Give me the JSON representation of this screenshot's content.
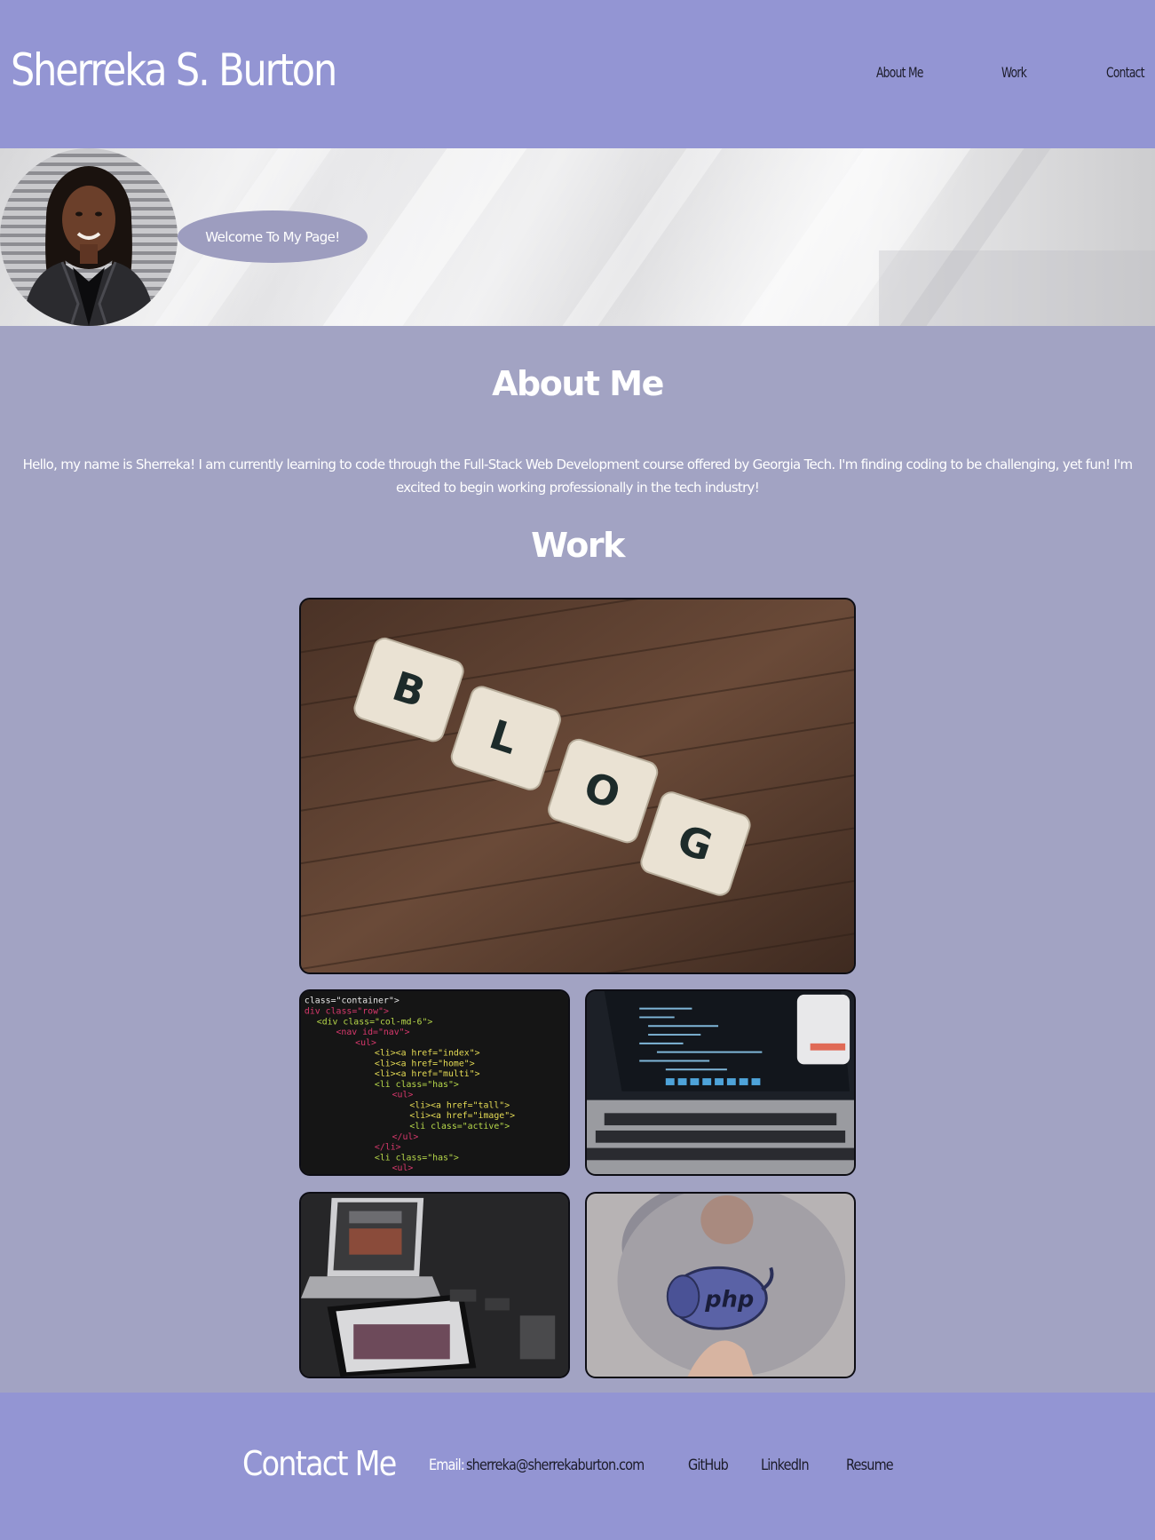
{
  "header": {
    "site_title": "Sherreka S. Burton",
    "nav": {
      "about": "About Me",
      "work": "Work",
      "contact": "Contact"
    },
    "background_color": "#9395d3"
  },
  "hero": {
    "welcome_text": "Welcome To My Page!",
    "avatar_alt": "profile-photo"
  },
  "about": {
    "title": "About Me",
    "text": "Hello, my name is Sherreka! I am currently learning to code through the Full-Stack Web Development course offered by Georgia Tech. I'm finding coding to be challenging, yet fun! I'm excited to begin working professionally in the tech industry!"
  },
  "work": {
    "title": "Work",
    "cards": [
      {
        "image": "blog-tiles-photo"
      },
      {
        "image": "html-code-photo"
      },
      {
        "image": "laptop-code-photo"
      },
      {
        "image": "devices-photo"
      },
      {
        "image": "php-sticker-photo"
      }
    ]
  },
  "footer": {
    "title": "Contact Me",
    "email_label": "Email:",
    "email": "sherreka@sherrekaburton.com",
    "github": "GitHub",
    "linkedin": "LinkedIn",
    "resume": "Resume"
  }
}
